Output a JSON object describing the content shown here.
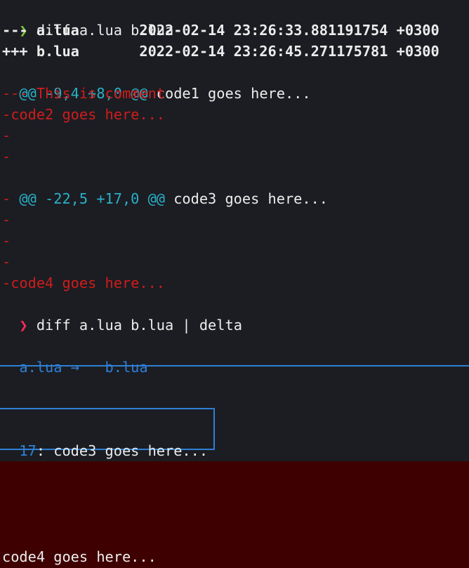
{
  "cmd1": {
    "prompt": "❯",
    "text": " diff a.lua b.lua"
  },
  "header": {
    "minus": "--- a.lua       2022-02-14 23:26:33.881191754 +0300",
    "plus": "+++ b.lua       2022-02-14 23:26:45.271175781 +0300"
  },
  "hunk1": {
    "marker": "@@ -9,4 +8,0 @@",
    "context": " code1 goes here..."
  },
  "removed1": [
    "--- This is comment",
    "-code2 goes here...",
    "-",
    "-"
  ],
  "hunk2": {
    "marker": "@@ -22,5 +17,0 @@",
    "context": " code3 goes here..."
  },
  "removed2": [
    "-",
    "-",
    "-",
    "-",
    "-code4 goes here..."
  ],
  "cmd2": {
    "prompt": "❯",
    "text": " diff a.lua b.lua | delta"
  },
  "delta": {
    "file_old": "a.lua",
    "arrow": " →   ",
    "file_new": "b.lua",
    "hunk_line": "17",
    "hunk_text": ": code3 goes here...",
    "removed_line": "code4 goes here..."
  },
  "colors": {
    "background": "#1b1d22",
    "prompt_ok": "#7ec13a",
    "prompt_err": "#ff2b55",
    "removed": "#d01c1c",
    "hunk": "#2bb0c8",
    "delta_blue": "#2f7fd6",
    "delta_removed_bg": "#3f0001"
  }
}
